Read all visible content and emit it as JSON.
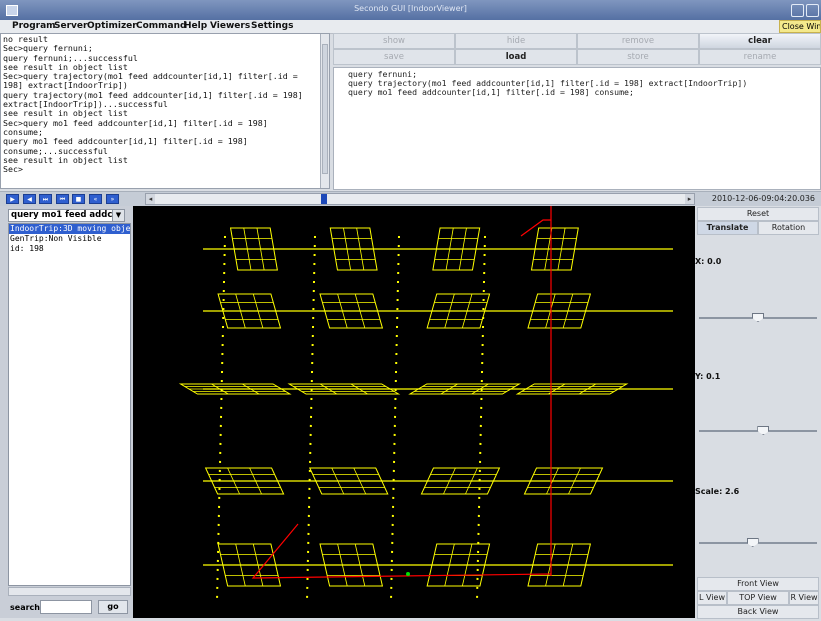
{
  "window": {
    "title": "Secondo GUI [IndoorViewer]"
  },
  "menu": [
    "Program",
    "Server",
    "Optimizer",
    "Command",
    "Help",
    "Viewers",
    "Settings"
  ],
  "close_window_label": "Close Wind",
  "console_text": "no result\nSec>query fernuni;\nquery fernuni;...successful\nsee result in object list\nSec>query trajectory(mo1 feed addcounter[id,1] filter[.id =\n198] extract[IndoorTrip])\nquery trajectory(mo1 feed addcounter[id,1] filter[.id = 198]\nextract[IndoorTrip])...successful\nsee result in object list\nSec>query mo1 feed addcounter[id,1] filter[.id = 198]\nconsume;\nquery mo1 feed addcounter[id,1] filter[.id = 198]\nconsume;...successful\nsee result in object list\nSec>",
  "buttons": {
    "show": "show",
    "hide": "hide",
    "remove": "remove",
    "clear": "clear",
    "save": "save",
    "load": "load",
    "store": "store",
    "rename": "rename"
  },
  "history_text": "query fernuni;\nquery trajectory(mo1 feed addcounter[id,1] filter[.id = 198] extract[IndoorTrip])\nquery mo1 feed addcounter[id,1] filter[.id = 198] consume;",
  "playback": {
    "time_label": "2010-12-06-09:04:20.036",
    "position": 0.33
  },
  "object_combo": "query mo1 feed addco...",
  "object_list": [
    "IndoorTrip:3D moving obje",
    "GenTrip:Non Visible",
    "id: 198"
  ],
  "search": {
    "label": "search",
    "value": "",
    "go_label": "go"
  },
  "right_panel": {
    "reset": "Reset",
    "translate": "Translate",
    "rotation": "Rotation",
    "x_label": "X: 0.0",
    "y_label": "Y: 0.1",
    "scale_label": "Scale: 2.6",
    "x_slider": 0.5,
    "y_slider": 0.55,
    "scale_slider": 0.45,
    "front_view": "Front View",
    "l_view": "L View",
    "top_view": "TOP View",
    "r_view": "R View",
    "back_view": "Back View"
  },
  "colors": {
    "floorplan": "#ffff00",
    "trajectory": "#ff0000",
    "accent": "#2f5fcf"
  }
}
